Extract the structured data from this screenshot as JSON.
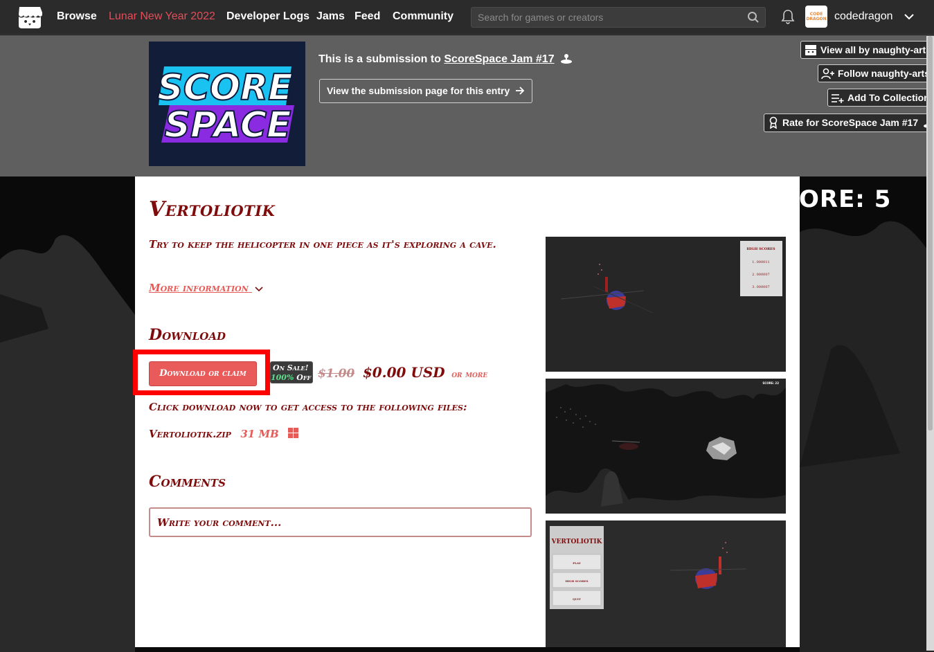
{
  "nav": {
    "links": [
      "Browse",
      "Lunar New Year 2022",
      "Developer Logs",
      "Jams",
      "Feed",
      "Community"
    ],
    "search_placeholder": "Search for games or creators",
    "avatar_text": "CODE DRAGON",
    "username": "codedragon"
  },
  "jam": {
    "logo_line1": "SCORE",
    "logo_line2": "SPACE",
    "submission_prefix": "This is a submission to",
    "jam_name": "ScoreSpace Jam #17",
    "view_submission": "View the submission page for this entry",
    "view_all": "View all by naughty-arts",
    "follow": "Follow naughty-arts",
    "add_collection": "Add To Collection",
    "rate": "Rate for ScoreSpace Jam #17"
  },
  "background": {
    "score_text": "ORE: 5"
  },
  "game": {
    "title": "Vertoliotik",
    "tagline": "Try to keep the helicopter in one piece as it's exploring a cave.",
    "more_info": "More information",
    "download_heading": "Download",
    "download_button": "Download or claim",
    "sale_label": "On Sale!",
    "sale_percent": "100%",
    "sale_off": "Off",
    "old_price": "$1.00",
    "new_price": "$0.00 USD",
    "or_more": "or more",
    "files_intro": "Click download now to get access to the following files:",
    "files": [
      {
        "name": "Vertoliotik.zip",
        "size": "31 MB",
        "platform": "windows-icon"
      }
    ],
    "comments_heading": "Comments",
    "comment_placeholder": "Write your comment..."
  },
  "screenshots": {
    "shot1": {
      "panel_title": "HIGH SCORES",
      "scores": [
        "1. 000011",
        "2. 000007",
        "3. 000007"
      ]
    },
    "shot2": {
      "score": "SCORE: 22"
    },
    "shot3": {
      "menu_title": "VERTOLIOTIK",
      "menu_items": [
        "PLAY",
        "HIGH SCORES",
        "QUIT"
      ]
    }
  },
  "colors": {
    "accent": "#7f0c0c",
    "button": "#e95b5b",
    "event_link": "#e64c59",
    "highlight": "#ff0000"
  }
}
